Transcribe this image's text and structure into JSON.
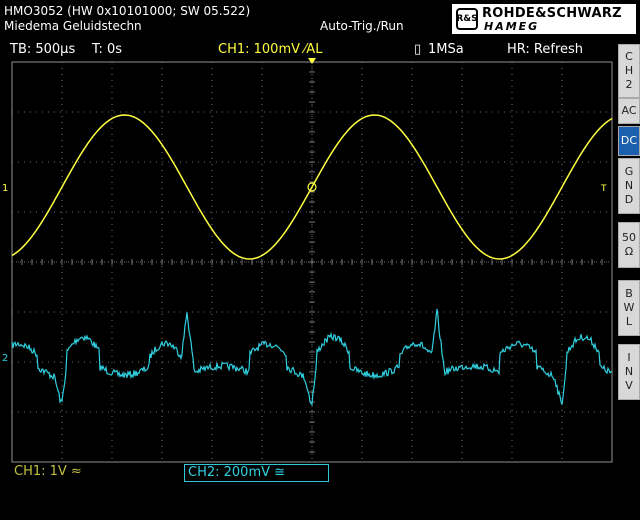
{
  "header": {
    "model": "HMO3052 (HW 0x10101000; SW 05.522)",
    "owner": "Miedema Geluidstechn",
    "trigger_mode": "Auto-Trig./Run"
  },
  "logo": {
    "badge": "R&S",
    "line1": "ROHDE&SCHWARZ",
    "line2": "HAMEG"
  },
  "status_bar": {
    "timebase": "TB: 500µs",
    "trigger_time": "T: 0s",
    "ch1_trigger": "CH1: 100mV ⁄AL",
    "sample_rate": "1MSa",
    "hr_mode": "HR: Refresh"
  },
  "side_menu": {
    "channel": [
      "C",
      "H",
      "2"
    ],
    "coupling_ac": "AC",
    "coupling_dc": "DC",
    "gnd": [
      "G",
      "N",
      "D"
    ],
    "impedance": [
      "50",
      "Ω"
    ],
    "bwl": [
      "B",
      "W",
      "L"
    ],
    "inv": [
      "I",
      "N",
      "V"
    ]
  },
  "markers": {
    "ch1": "1",
    "ch2": "2",
    "trigger": "T"
  },
  "bottom": {
    "ch1_scale": "CH1: 1V ≈",
    "ch2_scale": "CH2: 200mV ≅"
  },
  "colors": {
    "ch1": "#ffff40",
    "ch2": "#30d0e0",
    "grid": "#909090"
  },
  "waveforms": {
    "ch1": {
      "shape": "sine",
      "periods_on_screen": 2.4
    },
    "ch2": {
      "shape": "noisy distorted periodic",
      "periods_on_screen": 2.4
    }
  }
}
